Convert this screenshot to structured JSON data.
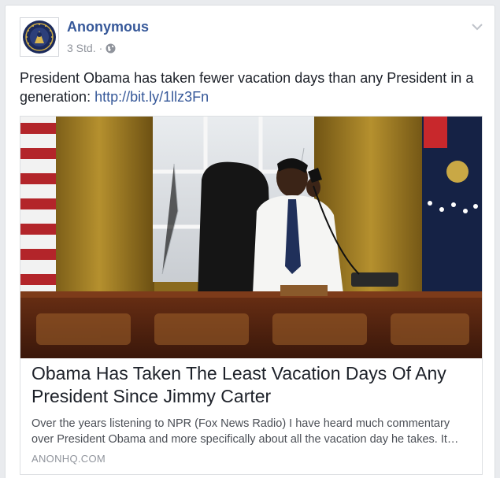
{
  "post": {
    "author": "Anonymous",
    "timestamp": "3 Std.",
    "separator": "·",
    "privacy_icon": "globe-icon",
    "menu_icon": "chevron-down-icon",
    "text": "President Obama has taken fewer vacation days than any President in a generation:",
    "link": "http://bit.ly/1llz3Fn"
  },
  "preview": {
    "image_icon": "oval-office-photo",
    "title": "Obama Has Taken The Least Vacation Days Of Any President Since Jimmy Carter",
    "description": "Over the years listening to NPR (Fox News Radio) I have heard much commentary over President Obama and more specifically about all the vacation day he takes. It…",
    "domain": "ANONHQ.COM"
  },
  "colors": {
    "link": "#365899",
    "text": "#1d2129",
    "muted": "#90949c",
    "background": "#e9ebee"
  }
}
